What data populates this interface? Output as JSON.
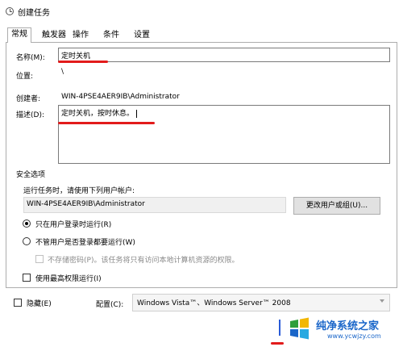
{
  "window": {
    "title": "创建任务"
  },
  "tabs": [
    {
      "label": "常规",
      "active": true
    },
    {
      "label": "触发器"
    },
    {
      "label": "操作"
    },
    {
      "label": "条件"
    },
    {
      "label": "设置"
    }
  ],
  "general": {
    "name_label": "名称(M):",
    "name_value": "定时关机",
    "location_label": "位置:",
    "location_value": "\\",
    "author_label": "创建者:",
    "author_value": "WIN-4PSE4AER9IB\\Administrator",
    "description_label": "描述(D):",
    "description_value": "定时关机，按时休息。"
  },
  "security": {
    "group_label": "安全选项",
    "run_as_prompt": "运行任务时，请使用下列用户帐户:",
    "user_account": "WIN-4PSE4AER9IB\\Administrator",
    "change_user_button": "更改用户或组(U)...",
    "option_logged_on": "只在用户登录时运行(R)",
    "option_whether_logged_on": "不管用户是否登录都要运行(W)",
    "do_not_store_password": "不存储密码(P)。该任务将只有访问本地计算机资源的权限。",
    "highest_privileges": "使用最高权限运行(I)",
    "selected_option": "option_logged_on"
  },
  "footer": {
    "hidden_label": "隐藏(E)",
    "configure_label": "配置(C):",
    "configure_value": "Windows Vista™、Windows Server™ 2008"
  },
  "watermark": {
    "title": "纯净系统之家",
    "url": "www.ycwjzy.com"
  },
  "colors": {
    "annotation_red": "#e21b1b",
    "watermark_blue": "#1a66c9",
    "logo_green": "#2e9e3a",
    "logo_yellow": "#f2b705",
    "logo_blue": "#1a66c9",
    "logo_cyan": "#27a9e1"
  }
}
